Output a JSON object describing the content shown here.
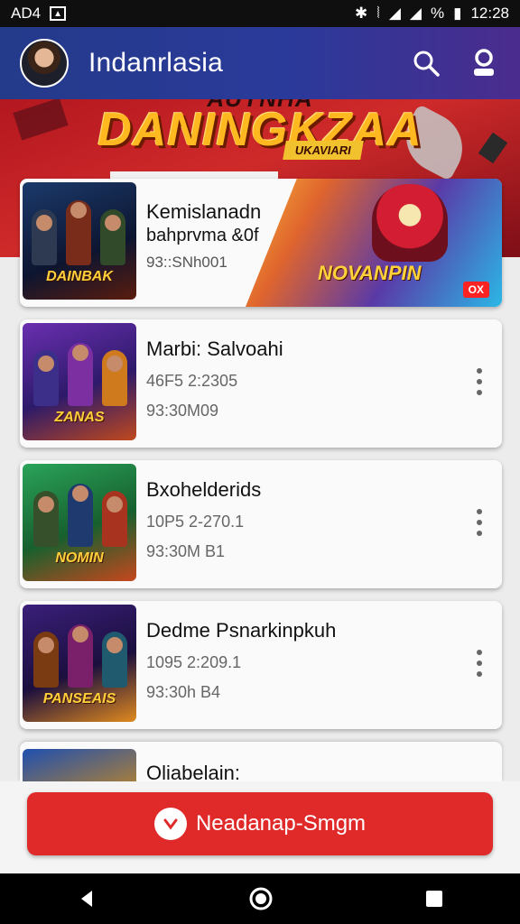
{
  "status_bar": {
    "carrier": "AD4",
    "battery": "%",
    "time": "12:28"
  },
  "app_bar": {
    "title": "Indanrlasia"
  },
  "banner": {
    "subtitle": "AUYNHA",
    "title": "DANINGKZAA",
    "tag": "UKAVIARI"
  },
  "featured": {
    "title": "Kemislanadn",
    "subtitle": "bahprvma &0f",
    "meta": "93::SNh001",
    "thumb_title": "DAINBAK",
    "art_label": "NOVANPIN",
    "badge": "OX"
  },
  "games": [
    {
      "title": "Marbi: Salvoahi",
      "meta1": "46F5 2:2305",
      "meta2": "93:30M09",
      "thumb_title": "ZANAS"
    },
    {
      "title": "Bxohelderids",
      "meta1": "10P5 2-270.1",
      "meta2": "93:30M B1",
      "thumb_title": "NOMIN"
    },
    {
      "title": "Dedme Psnarkinpkuh",
      "meta1": "1095 2:209.1",
      "meta2": "93:30h B4",
      "thumb_title": "PANSEAIS"
    }
  ],
  "partial_item": {
    "title": "Oliabelain:"
  },
  "primary_action": {
    "label": "Neadanap-Smgm"
  },
  "colors": {
    "header": "#2a3a9a",
    "accent": "#e02a2a",
    "banner": "#c11e24"
  },
  "icons": [
    "search-icon",
    "profile-icon",
    "download-icon",
    "back-icon",
    "home-icon",
    "recents-icon",
    "more-vert-icon"
  ]
}
